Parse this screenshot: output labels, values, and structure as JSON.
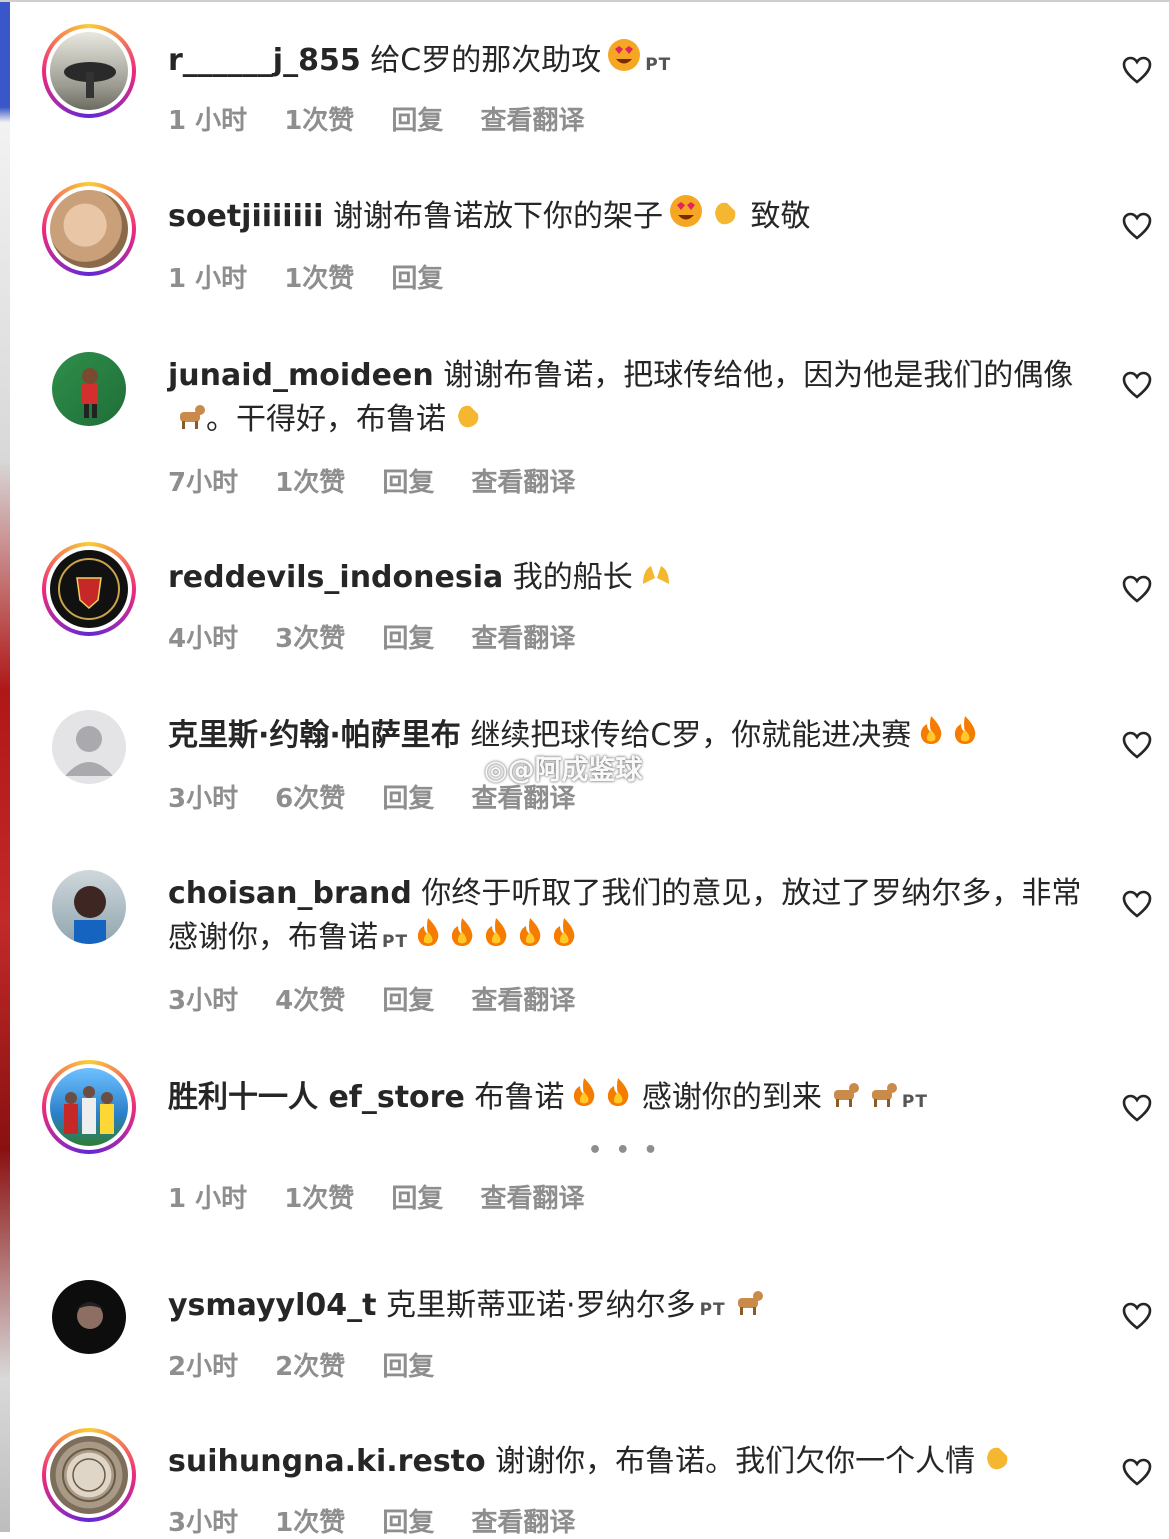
{
  "watermark": "@阿成鉴球",
  "more_dots": "• • •",
  "comments": [
    {
      "user": "r______j_855",
      "text": "给C罗的那次助攻",
      "emojis": [
        "heart-eyes"
      ],
      "tag": "PT",
      "time": "1 小时",
      "likes": "1次赞",
      "reply": "回复",
      "translate": "查看翻译"
    },
    {
      "user": "soetjiiiiiii",
      "text": "谢谢布鲁诺放下你的架子",
      "emojis": [
        "heart-eyes",
        "clap"
      ],
      "text2": "致敬",
      "time": "1 小时",
      "likes": "1次赞",
      "reply": "回复"
    },
    {
      "user": "junaid_moideen",
      "text": "谢谢布鲁诺，把球传给他，因为他是我们的偶像",
      "emojis": [
        "goat"
      ],
      "text2": "。干得好，布鲁诺",
      "emojis2": [
        "clap"
      ],
      "time": "7小时",
      "likes": "1次赞",
      "reply": "回复",
      "translate": "查看翻译"
    },
    {
      "user": "reddevils_indonesia",
      "text": "我的船长",
      "emojis": [
        "raised-hands"
      ],
      "time": "4小时",
      "likes": "3次赞",
      "reply": "回复",
      "translate": "查看翻译"
    },
    {
      "user": "克里斯·约翰·帕萨里布",
      "text": "继续把球传给C罗，你就能进决赛",
      "emojis": [
        "fire",
        "fire"
      ],
      "time": "3小时",
      "likes": "6次赞",
      "reply": "回复",
      "translate": "查看翻译"
    },
    {
      "user": "choisan_brand",
      "text": "你终于听取了我们的意见，放过了罗纳尔多，非常感谢你，布鲁诺",
      "tag": "PT",
      "emojis": [
        "fire",
        "fire",
        "fire",
        "fire",
        "fire"
      ],
      "time": "3小时",
      "likes": "4次赞",
      "reply": "回复",
      "translate": "查看翻译"
    },
    {
      "user": "胜利十一人 ef_store",
      "text": "布鲁诺",
      "emojis": [
        "fire",
        "fire"
      ],
      "text2": "感谢你的到来",
      "emojis2": [
        "goat",
        "goat"
      ],
      "tag": "PT",
      "time": "1 小时",
      "likes": "1次赞",
      "reply": "回复",
      "translate": "查看翻译"
    },
    {
      "user": "ysmayyl04_t",
      "text": "克里斯蒂亚诺·罗纳尔多",
      "tag": "PT",
      "emojis": [
        "goat"
      ],
      "time": "2小时",
      "likes": "2次赞",
      "reply": "回复"
    },
    {
      "user": "suihungna.ki.resto",
      "text": "谢谢你，布鲁诺。我们欠你一个人情",
      "emojis": [
        "clap"
      ],
      "time": "3小时",
      "likes": "1次赞",
      "reply": "回复",
      "translate": "查看翻译"
    }
  ]
}
